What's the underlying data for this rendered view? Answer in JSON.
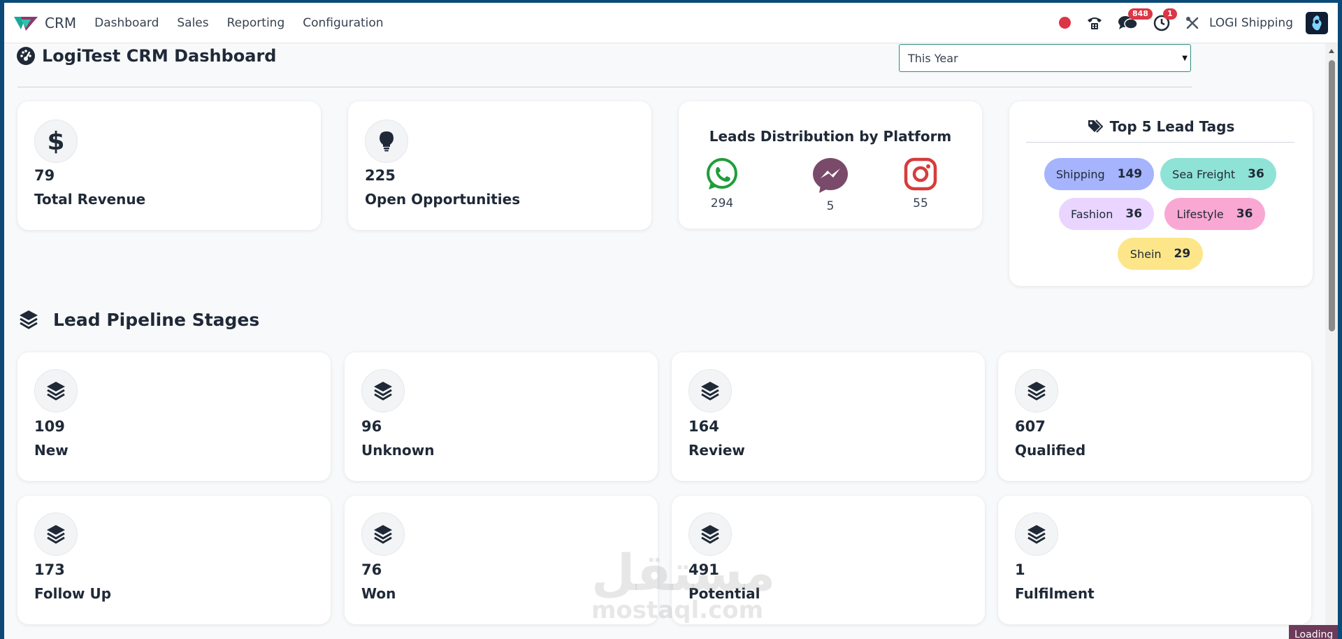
{
  "nav": {
    "brand": "CRM",
    "items": [
      "Dashboard",
      "Sales",
      "Reporting",
      "Configuration"
    ],
    "messages_badge": "848",
    "activity_badge": "1",
    "company": "LOGI Shipping"
  },
  "header": {
    "title": "LogiTest CRM Dashboard",
    "period": "This Year"
  },
  "kpis": [
    {
      "value": "79",
      "label": "Total Revenue",
      "icon": "dollar-icon"
    },
    {
      "value": "225",
      "label": "Open Opportunities",
      "icon": "lightbulb-icon"
    }
  ],
  "platforms": {
    "title": "Leads Distribution by Platform",
    "items": [
      {
        "name": "whatsapp",
        "count": "294",
        "color": "#1f9d3a"
      },
      {
        "name": "messenger",
        "count": "5",
        "color": "#7a4a6a"
      },
      {
        "name": "instagram",
        "count": "55",
        "color": "#d63c3c"
      }
    ]
  },
  "tags": {
    "title": "Top 5 Lead Tags",
    "items": [
      {
        "name": "Shipping",
        "count": "149",
        "color": "#a5b4fc"
      },
      {
        "name": "Sea Freight",
        "count": "36",
        "color": "#8fe3d6"
      },
      {
        "name": "Fashion",
        "count": "36",
        "color": "#e9d5ff"
      },
      {
        "name": "Lifestyle",
        "count": "36",
        "color": "#f9a8d4"
      },
      {
        "name": "Shein",
        "count": "29",
        "color": "#fde68a"
      }
    ]
  },
  "pipeline": {
    "title": "Lead Pipeline Stages",
    "stages": [
      {
        "value": "109",
        "label": "New"
      },
      {
        "value": "96",
        "label": "Unknown"
      },
      {
        "value": "164",
        "label": "Review"
      },
      {
        "value": "607",
        "label": "Qualified"
      },
      {
        "value": "173",
        "label": "Follow Up"
      },
      {
        "value": "76",
        "label": "Won"
      },
      {
        "value": "491",
        "label": "Potential"
      },
      {
        "value": "1",
        "label": "Fulfilment"
      }
    ]
  },
  "status": {
    "loading": "Loading"
  },
  "watermark": {
    "arabic": "مستقل",
    "latin": "mostaql.com"
  }
}
